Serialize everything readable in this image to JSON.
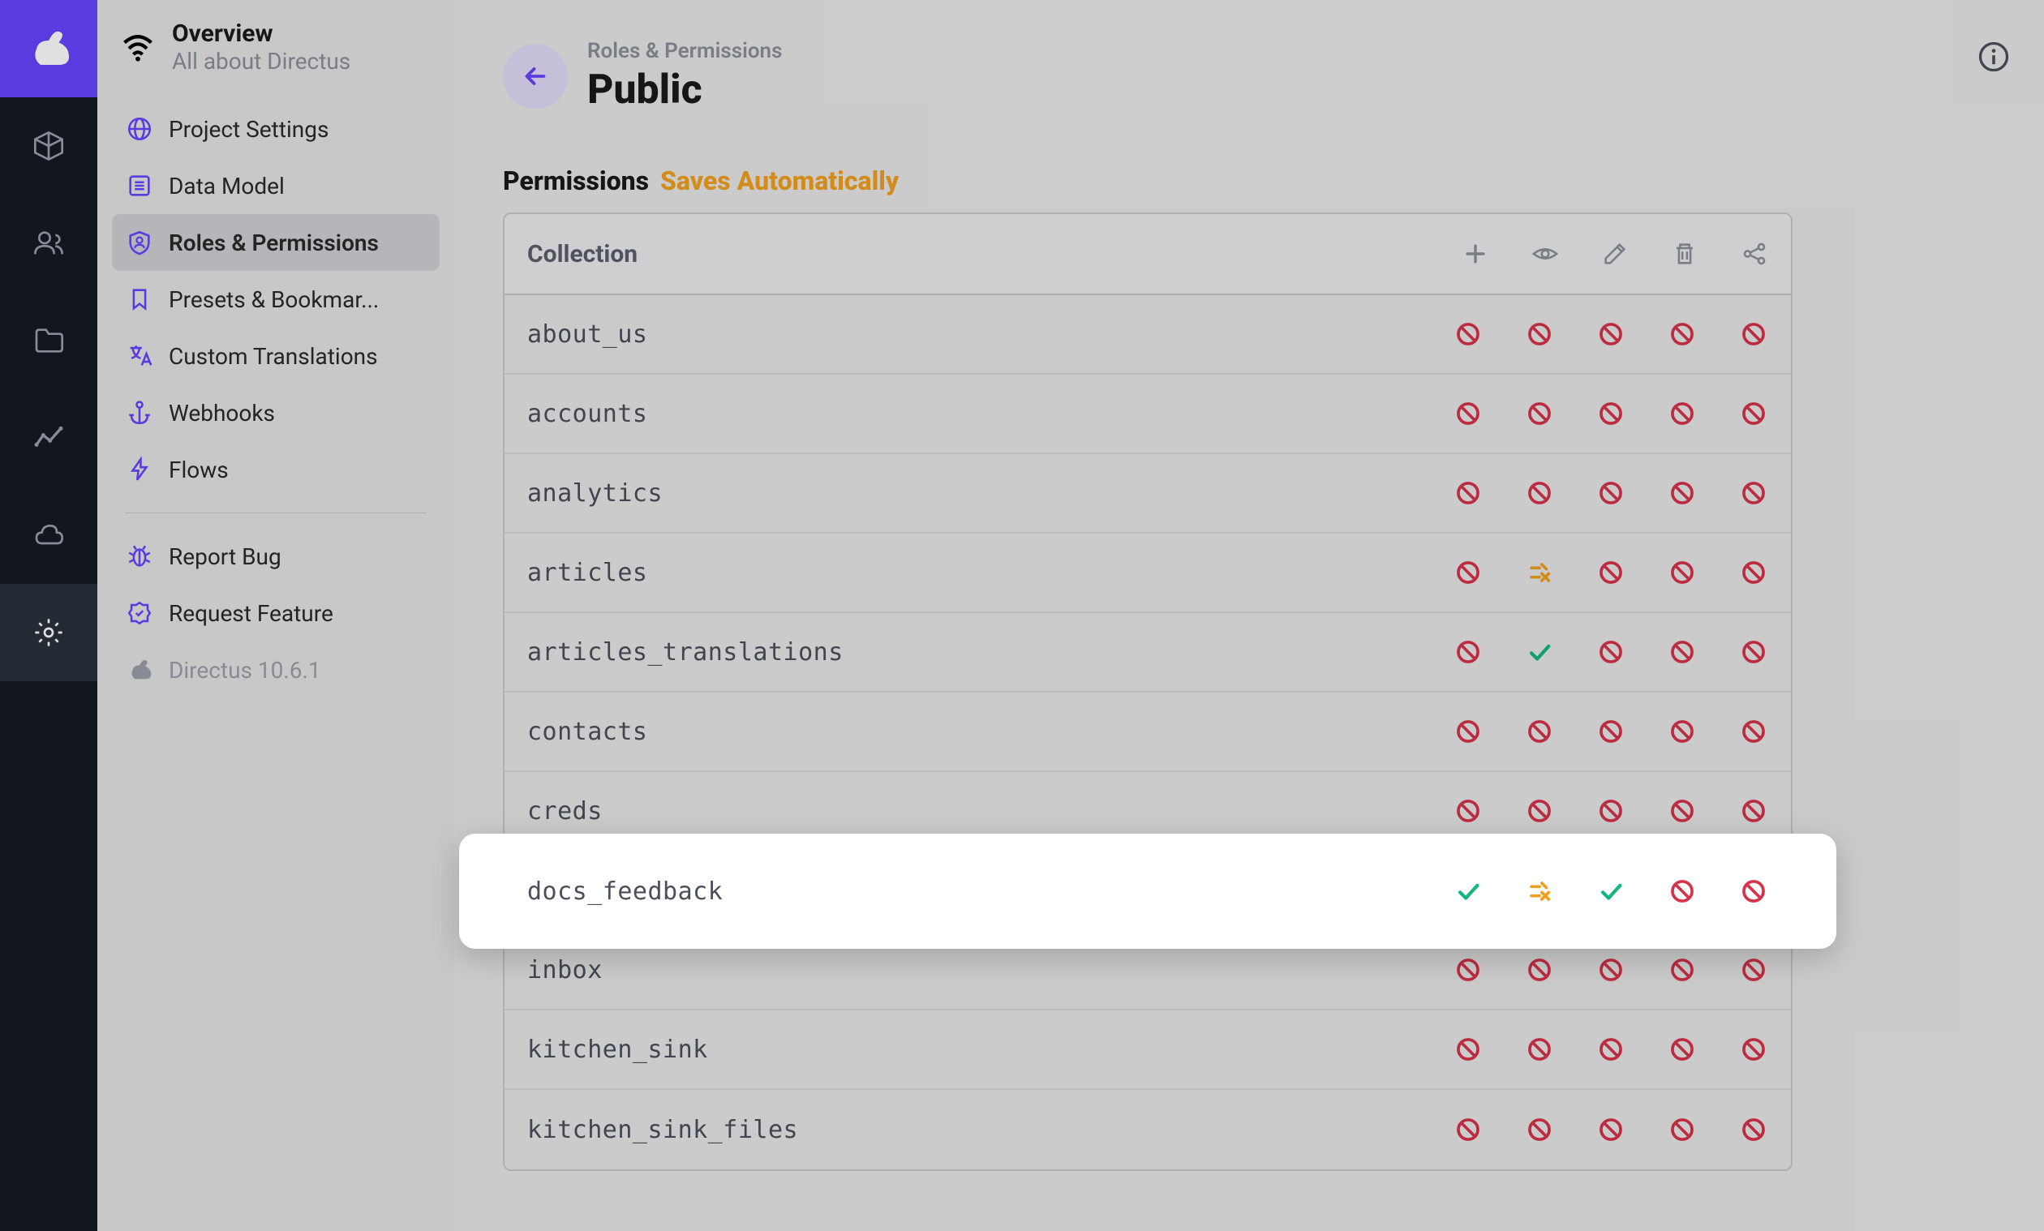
{
  "rail": {
    "items": [
      {
        "name": "logo-icon"
      },
      {
        "name": "cube-icon"
      },
      {
        "name": "users-icon"
      },
      {
        "name": "folder-icon"
      },
      {
        "name": "activity-icon"
      },
      {
        "name": "cloud-icon"
      },
      {
        "name": "settings-icon",
        "active": true
      }
    ]
  },
  "sidebar": {
    "title": "Overview",
    "subtitle": "All about Directus",
    "items": [
      {
        "icon": "globe",
        "label": "Project Settings"
      },
      {
        "icon": "list-box",
        "label": "Data Model"
      },
      {
        "icon": "shield-user",
        "label": "Roles & Permissions",
        "active": true
      },
      {
        "icon": "bookmark",
        "label": "Presets & Bookmar..."
      },
      {
        "icon": "translate",
        "label": "Custom Translations"
      },
      {
        "icon": "anchor",
        "label": "Webhooks"
      },
      {
        "icon": "bolt",
        "label": "Flows"
      }
    ],
    "footer": [
      {
        "icon": "bug",
        "label": "Report Bug"
      },
      {
        "icon": "badge",
        "label": "Request Feature"
      }
    ],
    "version_label": "Directus 10.6.1"
  },
  "header": {
    "breadcrumb": "Roles & Permissions",
    "title": "Public"
  },
  "permissions": {
    "label": "Permissions",
    "saves_label": "Saves Automatically",
    "column_header": "Collection",
    "action_icons": [
      "plus",
      "eye",
      "pencil",
      "trash",
      "share"
    ],
    "rows": [
      {
        "name": "about_us",
        "perms": [
          "deny",
          "deny",
          "deny",
          "deny",
          "deny"
        ]
      },
      {
        "name": "accounts",
        "perms": [
          "deny",
          "deny",
          "deny",
          "deny",
          "deny"
        ]
      },
      {
        "name": "analytics",
        "perms": [
          "deny",
          "deny",
          "deny",
          "deny",
          "deny"
        ]
      },
      {
        "name": "articles",
        "perms": [
          "deny",
          "partial",
          "deny",
          "deny",
          "deny"
        ]
      },
      {
        "name": "articles_translations",
        "perms": [
          "deny",
          "allow",
          "deny",
          "deny",
          "deny"
        ]
      },
      {
        "name": "contacts",
        "perms": [
          "deny",
          "deny",
          "deny",
          "deny",
          "deny"
        ]
      },
      {
        "name": "creds",
        "perms": [
          "deny",
          "deny",
          "deny",
          "deny",
          "deny"
        ]
      },
      {
        "name": "docs_feedback",
        "perms": [
          "allow",
          "partial",
          "allow",
          "deny",
          "deny"
        ],
        "highlight": true
      },
      {
        "name": "inbox",
        "perms": [
          "deny",
          "deny",
          "deny",
          "deny",
          "deny"
        ]
      },
      {
        "name": "kitchen_sink",
        "perms": [
          "deny",
          "deny",
          "deny",
          "deny",
          "deny"
        ]
      },
      {
        "name": "kitchen_sink_files",
        "perms": [
          "deny",
          "deny",
          "deny",
          "deny",
          "deny"
        ]
      }
    ]
  }
}
